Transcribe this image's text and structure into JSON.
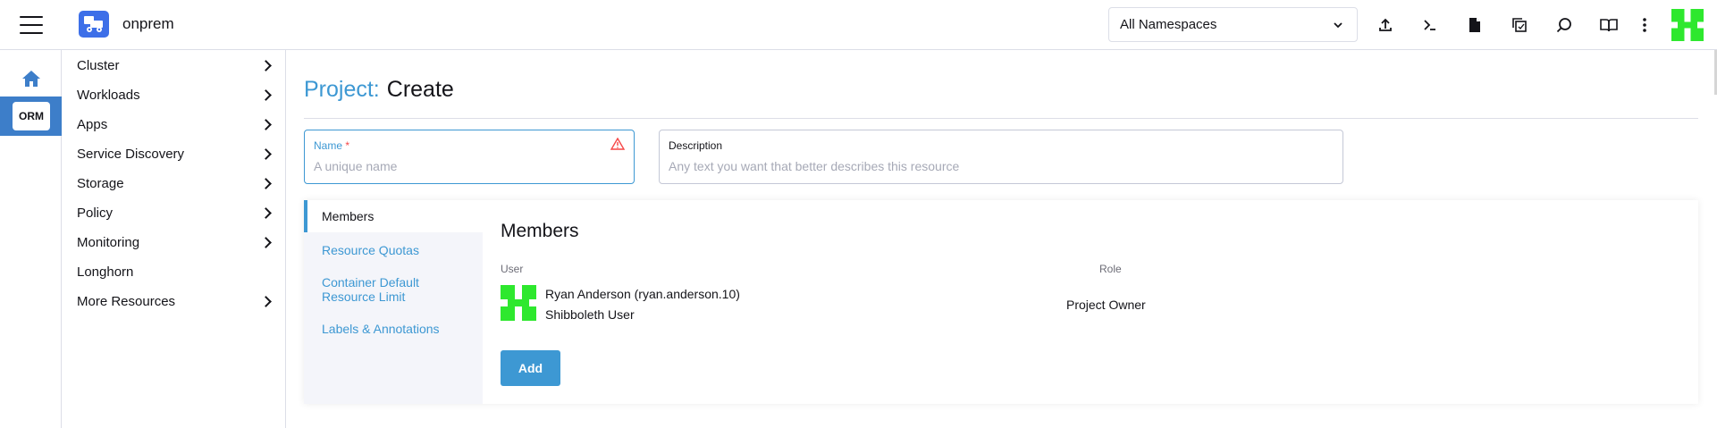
{
  "header": {
    "cluster_name": "onprem",
    "namespace_filter": "All Namespaces",
    "icons": [
      "import-yaml-icon",
      "kubectl-shell-icon",
      "kubeconfig-download-icon",
      "copy-kubeconfig-icon",
      "resource-search-icon",
      "docs-book-icon",
      "more-vertical-icon",
      "user-avatar-icon"
    ]
  },
  "rail": {
    "home_icon": "home-icon",
    "active_item": "ORM"
  },
  "sidenav": {
    "items": [
      {
        "label": "Cluster",
        "has_children": true
      },
      {
        "label": "Workloads",
        "has_children": true
      },
      {
        "label": "Apps",
        "has_children": true
      },
      {
        "label": "Service Discovery",
        "has_children": true
      },
      {
        "label": "Storage",
        "has_children": true
      },
      {
        "label": "Policy",
        "has_children": true
      },
      {
        "label": "Monitoring",
        "has_children": true
      },
      {
        "label": "Longhorn",
        "has_children": false
      },
      {
        "label": "More Resources",
        "has_children": true
      }
    ]
  },
  "page": {
    "title_prefix": "Project:",
    "title_mode": "Create"
  },
  "form": {
    "name": {
      "label": "Name",
      "required_mark": "*",
      "placeholder": "A unique name",
      "value": ""
    },
    "description": {
      "label": "Description",
      "placeholder": "Any text you want that better describes this resource",
      "value": ""
    }
  },
  "tabs": [
    {
      "label": "Members",
      "active": true
    },
    {
      "label": "Resource Quotas",
      "active": false
    },
    {
      "label": "Container Default Resource Limit",
      "active": false
    },
    {
      "label": "Labels & Annotations",
      "active": false
    }
  ],
  "members": {
    "section_title": "Members",
    "columns": {
      "user": "User",
      "role": "Role"
    },
    "rows": [
      {
        "user_name": "Ryan Anderson (ryan.anderson.10)",
        "user_type": "Shibboleth User",
        "role": "Project Owner"
      }
    ],
    "add_label": "Add"
  },
  "colors": {
    "accent": "#3d98d3",
    "rail_active": "#3d7ec9",
    "logo_bg": "#3d6fe8",
    "avatar_green": "#2ee82e",
    "warning": "#f64747"
  }
}
